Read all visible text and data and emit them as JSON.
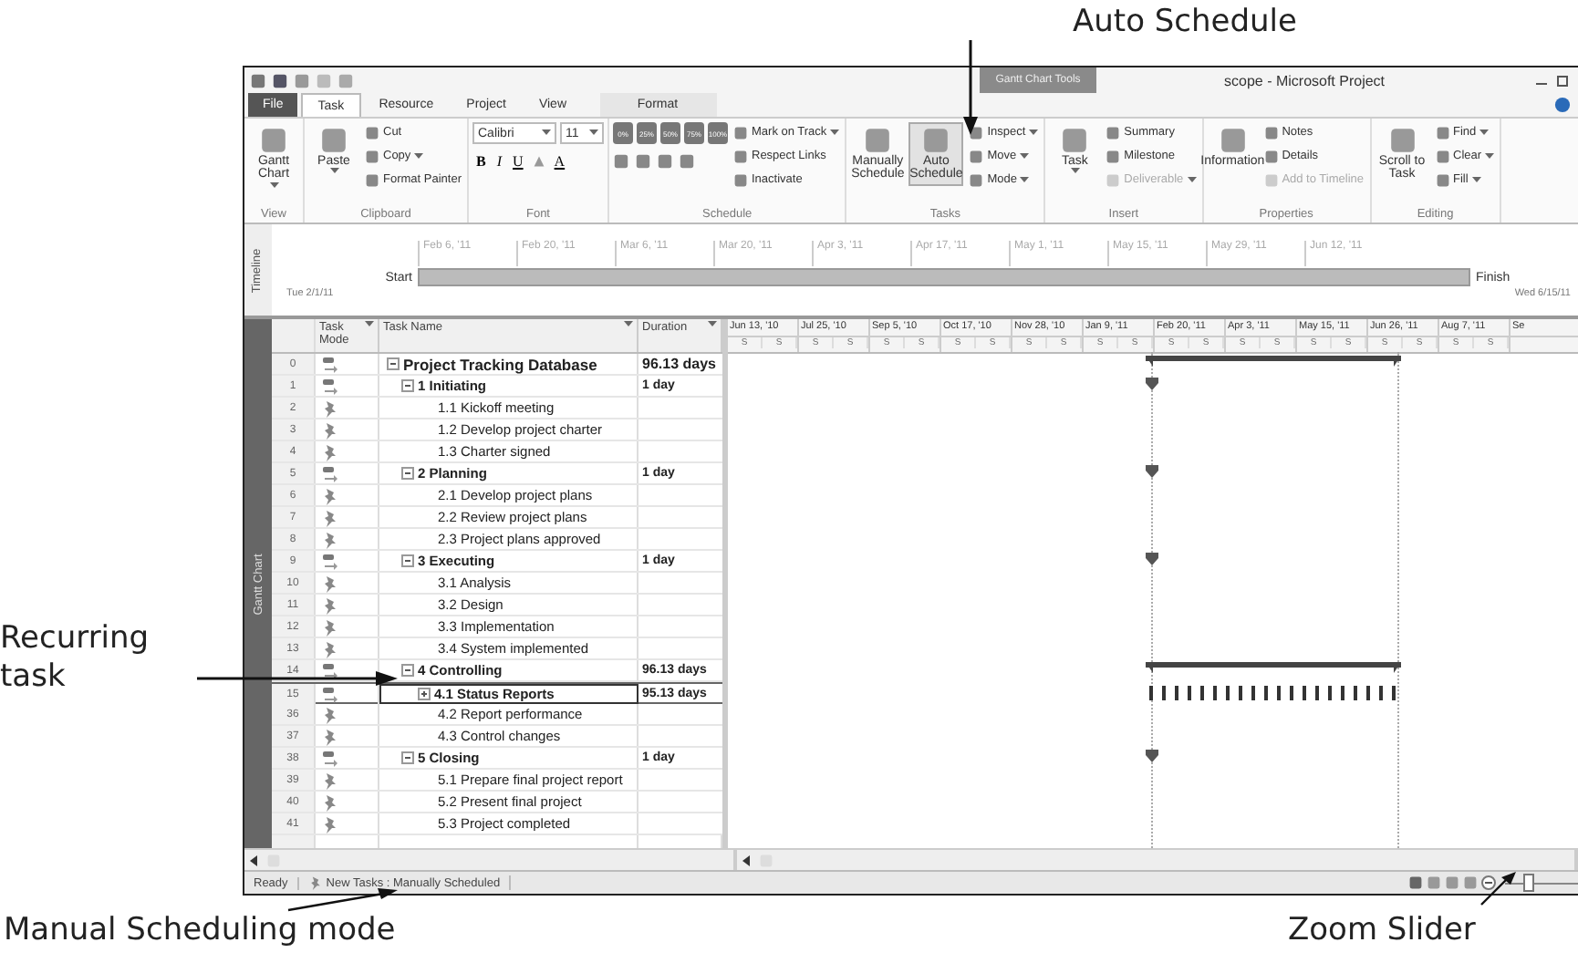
{
  "callouts": [
    {
      "text": "Auto Schedule"
    },
    {
      "text": "Recurring task"
    },
    {
      "text": "Manual Scheduling mode"
    },
    {
      "text": "Zoom Slider"
    }
  ],
  "title_bar": {
    "contextual_tab": "Gantt Chart Tools",
    "title": "scope - Microsoft Project"
  },
  "tabs": [
    {
      "label": "File",
      "kind": "file",
      "selected": false
    },
    {
      "label": "Task",
      "kind": "tab",
      "selected": true
    },
    {
      "label": "Resource",
      "kind": "tab",
      "selected": false
    },
    {
      "label": "Project",
      "kind": "tab",
      "selected": false
    },
    {
      "label": "View",
      "kind": "tab",
      "selected": false
    },
    {
      "label": "Format",
      "kind": "contextual",
      "selected": false
    }
  ],
  "ribbon": [
    {
      "kind": "buttons",
      "label": "View",
      "items": [
        {
          "label": "Gantt Chart",
          "kind": "large",
          "dropdown": true,
          "disabled": false,
          "on": false
        }
      ]
    },
    {
      "kind": "buttons",
      "label": "Clipboard",
      "items": [
        {
          "label": "Paste",
          "kind": "large",
          "dropdown": true,
          "disabled": false,
          "on": false
        },
        {
          "label": "Cut",
          "kind": "small",
          "dropdown": false,
          "disabled": false,
          "on": false
        },
        {
          "label": "Copy",
          "kind": "small",
          "dropdown": true,
          "disabled": false,
          "on": false
        },
        {
          "label": "Format Painter",
          "kind": "small",
          "dropdown": false,
          "disabled": false,
          "on": false
        }
      ]
    },
    {
      "kind": "font",
      "label": "Font",
      "font": "Calibri",
      "size": "11",
      "styles": [
        "B",
        "I",
        "U"
      ],
      "color_letter": "A"
    },
    {
      "kind": "schedule",
      "label": "Schedule",
      "percents": [
        "0%",
        "25%",
        "50%",
        "75%",
        "100%"
      ],
      "items": [
        {
          "label": "Mark on Track",
          "kind": "small",
          "dropdown": true,
          "disabled": false,
          "on": false
        },
        {
          "label": "Respect Links",
          "kind": "small",
          "dropdown": false,
          "disabled": false,
          "on": false
        },
        {
          "label": "Inactivate",
          "kind": "small",
          "dropdown": false,
          "disabled": false,
          "on": false
        }
      ]
    },
    {
      "kind": "buttons",
      "label": "Tasks",
      "items": [
        {
          "label": "Manually Schedule",
          "kind": "large",
          "dropdown": false,
          "disabled": false,
          "on": false
        },
        {
          "label": "Auto Schedule",
          "kind": "large",
          "dropdown": false,
          "disabled": false,
          "on": true
        },
        {
          "label": "Inspect",
          "kind": "small",
          "dropdown": true,
          "disabled": false,
          "on": false
        },
        {
          "label": "Move",
          "kind": "small",
          "dropdown": true,
          "disabled": false,
          "on": false
        },
        {
          "label": "Mode",
          "kind": "small",
          "dropdown": true,
          "disabled": false,
          "on": false
        }
      ]
    },
    {
      "kind": "buttons",
      "label": "Insert",
      "items": [
        {
          "label": "Task",
          "kind": "large",
          "dropdown": true,
          "disabled": false,
          "on": false
        },
        {
          "label": "Summary",
          "kind": "small",
          "dropdown": false,
          "disabled": false,
          "on": false
        },
        {
          "label": "Milestone",
          "kind": "small",
          "dropdown": false,
          "disabled": false,
          "on": false
        },
        {
          "label": "Deliverable",
          "kind": "small",
          "dropdown": true,
          "disabled": true,
          "on": false
        }
      ]
    },
    {
      "kind": "buttons",
      "label": "Properties",
      "items": [
        {
          "label": "Information",
          "kind": "large",
          "dropdown": false,
          "disabled": false,
          "on": false
        },
        {
          "label": "Notes",
          "kind": "small",
          "dropdown": false,
          "disabled": false,
          "on": false
        },
        {
          "label": "Details",
          "kind": "small",
          "dropdown": false,
          "disabled": false,
          "on": false
        },
        {
          "label": "Add to Timeline",
          "kind": "small",
          "dropdown": false,
          "disabled": true,
          "on": false
        }
      ]
    },
    {
      "kind": "buttons",
      "label": "Editing",
      "items": [
        {
          "label": "Scroll to Task",
          "kind": "large",
          "dropdown": false,
          "disabled": false,
          "on": false
        },
        {
          "label": "Find",
          "kind": "small",
          "dropdown": true,
          "disabled": false,
          "on": false
        },
        {
          "label": "Clear",
          "kind": "small",
          "dropdown": true,
          "disabled": false,
          "on": false
        },
        {
          "label": "Fill",
          "kind": "small",
          "dropdown": true,
          "disabled": false,
          "on": false
        }
      ]
    }
  ],
  "timeline": {
    "label": "Timeline",
    "dates": [
      "Feb 6, '11",
      "Feb 20, '11",
      "Mar 6, '11",
      "Mar 20, '11",
      "Apr 3, '11",
      "Apr 17, '11",
      "May 1, '11",
      "May 15, '11",
      "May 29, '11",
      "Jun 12, '11"
    ],
    "start_label": "Start",
    "start_date": "Tue 2/1/11",
    "finish_label": "Finish",
    "finish_date": "Wed 6/15/11"
  },
  "view_bar": {
    "label": "Gantt Chart"
  },
  "table": {
    "columns": [
      {
        "label": "Task Mode"
      },
      {
        "label": "Task Name"
      },
      {
        "label": "Duration"
      }
    ],
    "rows": [
      {
        "id": "0",
        "auto_scheduled": true,
        "name": "Project Tracking Database",
        "duration": "96.13 days",
        "kind": "summary",
        "expanded": true,
        "selected": false,
        "children": [
          {
            "id": "1",
            "auto_scheduled": true,
            "name": "1 Initiating",
            "duration": "1 day",
            "kind": "milestone",
            "expanded": true,
            "selected": false,
            "children": [
              {
                "id": "2",
                "auto_scheduled": false,
                "name": "1.1 Kickoff meeting",
                "kind": "task",
                "selected": false
              },
              {
                "id": "3",
                "auto_scheduled": false,
                "name": "1.2 Develop project charter",
                "kind": "task",
                "selected": false
              },
              {
                "id": "4",
                "auto_scheduled": false,
                "name": "1.3 Charter signed",
                "kind": "task",
                "selected": false
              }
            ]
          },
          {
            "id": "5",
            "auto_scheduled": true,
            "name": "2 Planning",
            "duration": "1 day",
            "kind": "milestone",
            "expanded": true,
            "selected": false,
            "children": [
              {
                "id": "6",
                "auto_scheduled": false,
                "name": "2.1 Develop project plans",
                "kind": "task",
                "selected": false
              },
              {
                "id": "7",
                "auto_scheduled": false,
                "name": "2.2 Review project plans",
                "kind": "task",
                "selected": false
              },
              {
                "id": "8",
                "auto_scheduled": false,
                "name": "2.3 Project plans approved",
                "kind": "task",
                "selected": false
              }
            ]
          },
          {
            "id": "9",
            "auto_scheduled": true,
            "name": "3 Executing",
            "duration": "1 day",
            "kind": "milestone",
            "expanded": true,
            "selected": false,
            "children": [
              {
                "id": "10",
                "auto_scheduled": false,
                "name": "3.1 Analysis",
                "kind": "task",
                "selected": false
              },
              {
                "id": "11",
                "auto_scheduled": false,
                "name": "3.2 Design",
                "kind": "task",
                "selected": false
              },
              {
                "id": "12",
                "auto_scheduled": false,
                "name": "3.3 Implementation",
                "kind": "task",
                "selected": false
              },
              {
                "id": "13",
                "auto_scheduled": false,
                "name": "3.4 System implemented",
                "kind": "task",
                "selected": false
              }
            ]
          },
          {
            "id": "14",
            "auto_scheduled": true,
            "name": "4 Controlling",
            "duration": "96.13 days",
            "kind": "summary",
            "expanded": true,
            "selected": false,
            "children": [
              {
                "id": "15",
                "auto_scheduled": true,
                "name": "4.1 Status Reports",
                "duration": "95.13 days",
                "kind": "recurring",
                "expanded": false,
                "selected": true
              },
              {
                "id": "36",
                "auto_scheduled": false,
                "name": "4.2 Report performance",
                "kind": "task",
                "selected": false
              },
              {
                "id": "37",
                "auto_scheduled": false,
                "name": "4.3 Control changes",
                "kind": "task",
                "selected": false
              }
            ]
          },
          {
            "id": "38",
            "auto_scheduled": true,
            "name": "5 Closing",
            "duration": "1 day",
            "kind": "milestone",
            "expanded": true,
            "selected": false,
            "children": [
              {
                "id": "39",
                "auto_scheduled": false,
                "name": "5.1 Prepare final project report",
                "kind": "task",
                "selected": false
              },
              {
                "id": "40",
                "auto_scheduled": false,
                "name": "5.2 Present final project",
                "kind": "task",
                "selected": false
              },
              {
                "id": "41",
                "auto_scheduled": false,
                "name": "5.3 Project completed",
                "kind": "task",
                "selected": false
              }
            ]
          }
        ]
      }
    ]
  },
  "gantt": {
    "periods": [
      {
        "label": "Jun 13, '10",
        "days": [
          "S",
          "S"
        ]
      },
      {
        "label": "Jul 25, '10",
        "days": [
          "S",
          "S"
        ]
      },
      {
        "label": "Sep 5, '10",
        "days": [
          "S",
          "S"
        ]
      },
      {
        "label": "Oct 17, '10",
        "days": [
          "S",
          "S"
        ]
      },
      {
        "label": "Nov 28, '10",
        "days": [
          "S",
          "S"
        ]
      },
      {
        "label": "Jan 9, '11",
        "days": [
          "S",
          "S"
        ]
      },
      {
        "label": "Feb 20, '11",
        "days": [
          "S",
          "S"
        ]
      },
      {
        "label": "Apr 3, '11",
        "days": [
          "S",
          "S"
        ]
      },
      {
        "label": "May 15, '11",
        "days": [
          "S",
          "S"
        ]
      },
      {
        "label": "Jun 26, '11",
        "days": [
          "S",
          "S"
        ]
      },
      {
        "label": "Aug 7, '11",
        "days": [
          "S",
          "S"
        ]
      },
      {
        "label": "Se"
      }
    ]
  },
  "status_bar": {
    "ready": "Ready",
    "new_tasks": "New Tasks : Manually Scheduled",
    "zoom": {
      "level": 0.3
    }
  }
}
